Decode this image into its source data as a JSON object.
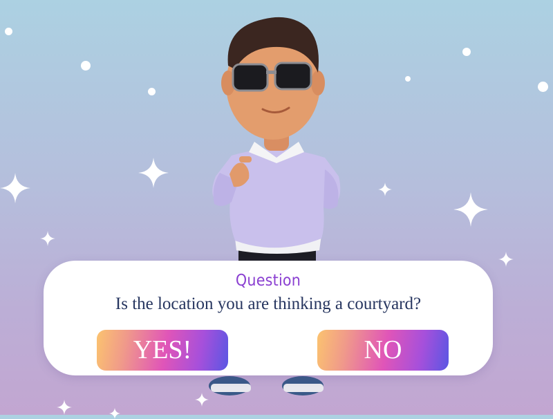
{
  "dialog": {
    "title": "Question",
    "question": "Is the location you are thinking a courtyard?",
    "yes_label": "YES!",
    "no_label": "NO"
  },
  "colors": {
    "title": "#8a3fd1",
    "question_text": "#26355f",
    "button_gradient_start": "#fbc36f",
    "button_gradient_mid": "#e055b8",
    "button_gradient_end": "#5a56e3"
  },
  "icons": [
    "sparkle-icon",
    "avatar-character"
  ]
}
